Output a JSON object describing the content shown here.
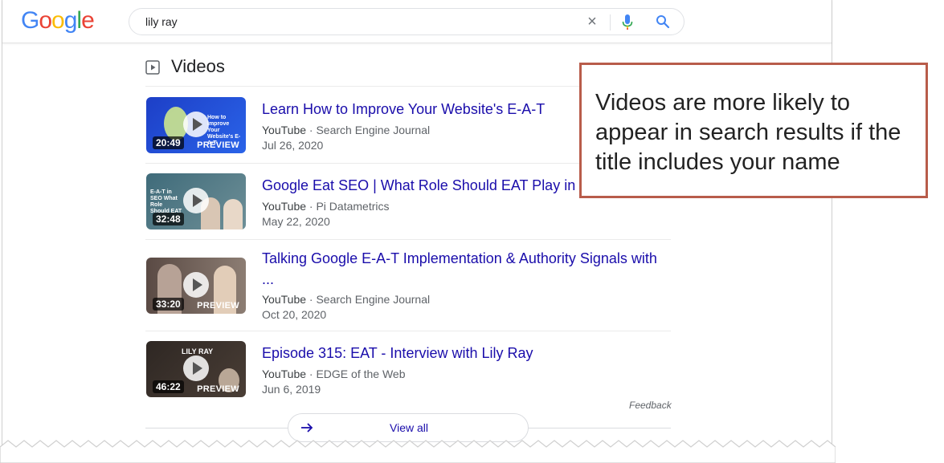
{
  "header": {
    "logo": [
      "G",
      "o",
      "o",
      "g",
      "l",
      "e"
    ],
    "logo_colors": [
      "#4285F4",
      "#EA4335",
      "#FBBC05",
      "#4285F4",
      "#34A853",
      "#EA4335"
    ],
    "search_value": "lily ray",
    "clear_glyph": "×"
  },
  "section": {
    "title": "Videos"
  },
  "videos": [
    {
      "title": "Learn How to Improve Your Website's E-A-T",
      "source": "YouTube",
      "channel": "Search Engine Journal",
      "date": "Jul 26, 2020",
      "duration": "20:49",
      "preview": "PREVIEW",
      "thumb_text": "How to Improve Your Website's E-A-T",
      "thumb_colors": [
        "#1d3fc7",
        "#2a63e8"
      ]
    },
    {
      "title": "Google Eat SEO | What Role Should EAT Play in Y",
      "source": "YouTube",
      "channel": "Pi Datametrics",
      "date": "May 22, 2020",
      "duration": "32:48",
      "preview": "",
      "thumb_text": "E-A-T in SEO What Role Should EAT",
      "thumb_colors": [
        "#3f6b7a",
        "#6e8f97"
      ]
    },
    {
      "title": "Talking Google E-A-T Implementation & Authority Signals with ...",
      "source": "YouTube",
      "channel": "Search Engine Journal",
      "date": "Oct 20, 2020",
      "duration": "33:20",
      "preview": "PREVIEW",
      "thumb_text": "",
      "thumb_colors": [
        "#5a4a44",
        "#8c7d73"
      ]
    },
    {
      "title": "Episode 315: EAT - Interview with Lily Ray",
      "source": "YouTube",
      "channel": "EDGE of the Web",
      "date": "Jun 6, 2019",
      "duration": "46:22",
      "preview": "PREVIEW",
      "thumb_text": "LILY RAY",
      "thumb_colors": [
        "#2e2723",
        "#4a3e36"
      ]
    }
  ],
  "feedback": "Feedback",
  "view_all": "View all",
  "callout": {
    "text": "Videos are more likely to appear in search results if the title includes your name",
    "border_color": "#b85c4a"
  },
  "colors": {
    "link": "#1a0dab",
    "meta": "#5f6368"
  }
}
